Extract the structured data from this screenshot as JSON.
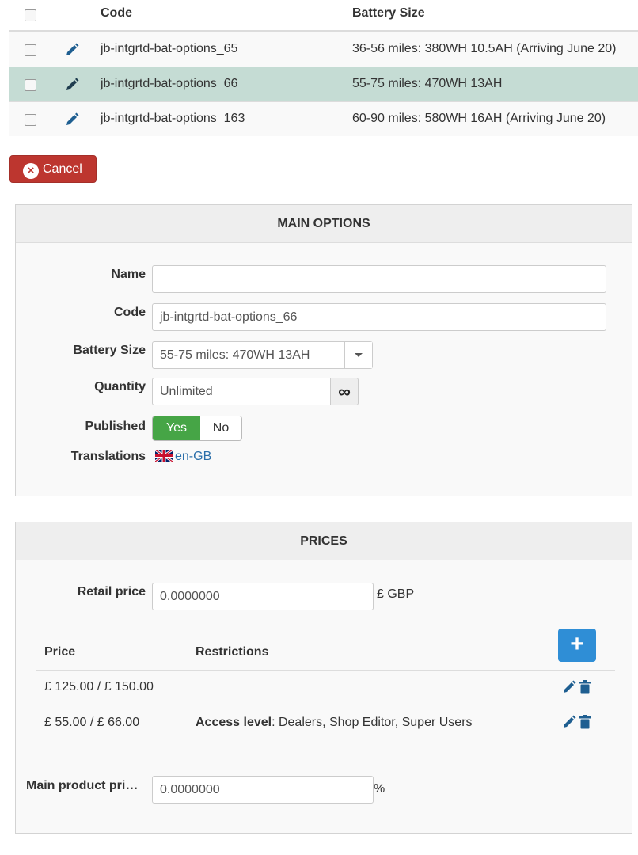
{
  "variants": {
    "headers": {
      "code": "Code",
      "battery_size": "Battery Size"
    },
    "rows": [
      {
        "code": "jb-intgrtd-bat-options_65",
        "battery_size": "36-56 miles: 380WH 10.5AH (Arriving June 20)"
      },
      {
        "code": "jb-intgrtd-bat-options_66",
        "battery_size": "55-75 miles: 470WH 13AH"
      },
      {
        "code": "jb-intgrtd-bat-options_163",
        "battery_size": "60-90 miles: 580WH 16AH (Arriving June 20)"
      }
    ],
    "selected_index": 1
  },
  "cancel": {
    "label": "Cancel",
    "icon": "circle-x-icon"
  },
  "main_options": {
    "title": "MAIN OPTIONS",
    "name_label": "Name",
    "name_value": "",
    "code_label": "Code",
    "code_value": "jb-intgrtd-bat-options_66",
    "battery_label": "Battery Size",
    "battery_value": "55-75 miles: 470WH 13AH",
    "quantity_label": "Quantity",
    "quantity_value": "Unlimited",
    "quantity_addon": "∞",
    "published_label": "Published",
    "published_yes": "Yes",
    "published_no": "No",
    "published_value": "Yes",
    "translations_label": "Translations",
    "translation_link": "en-GB",
    "translation_flag": "uk-flag-icon"
  },
  "prices": {
    "title": "PRICES",
    "retail_label": "Retail price",
    "retail_value": "0.0000000",
    "retail_unit": "£ GBP",
    "col_price": "Price",
    "col_restrictions": "Restrictions",
    "add_button": "+",
    "rows": [
      {
        "price": "£ 125.00 / £ 150.00",
        "restriction_label": "",
        "restriction_value": ""
      },
      {
        "price": "£ 55.00 / £ 66.00",
        "restriction_label": "Access level",
        "restriction_value": ": Dealers, Shop Editor, Super Users"
      }
    ],
    "main_product_label": "Main product pri…",
    "main_product_value": "0.0000000",
    "main_product_unit": "%"
  },
  "colors": {
    "selected_row": "#c5dcd4",
    "cancel": "#bd362f",
    "published_yes": "#46a546",
    "primary": "#2f8ed6",
    "link": "#2a6ea9",
    "icon_blue": "#1f5f91"
  }
}
